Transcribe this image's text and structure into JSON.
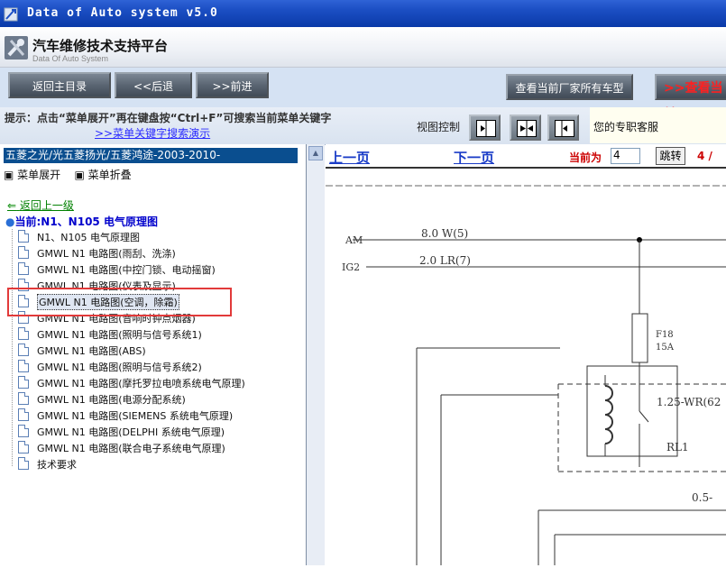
{
  "window": {
    "title": "Data of Auto system v5.0"
  },
  "header": {
    "title": "汽车维修技术支持平台",
    "subtitle": "Data Of Auto System"
  },
  "toolbar": {
    "home": "返回主目录",
    "back": "<<后退",
    "forward": ">>前进",
    "all_models": "查看当前厂家所有车型",
    "view_current": ">>查看当前"
  },
  "hints": {
    "tip": "提示：点击“菜单展开”再在键盘按“Ctrl+F”可搜索当前菜单关键字",
    "search_link": ">>菜单关键字搜索演示",
    "view_control": "视图控制",
    "agent": "您的专职客服"
  },
  "sidebar": {
    "breadcrumb": "五菱之光/光五菱扬光/五菱鸿途-2003-2010-",
    "expand": "菜单展开",
    "collapse": "菜单折叠",
    "back_up": "返回上一级",
    "current": "当前:N1、N105 电气原理图",
    "items": [
      {
        "label": "N1、N105 电气原理图"
      },
      {
        "label": "GMWL N1 电路图(雨刮、洗涤)"
      },
      {
        "label": "GMWL N1 电路图(中控门锁、电动摇窗)"
      },
      {
        "label": "GMWL N1 电路图(仪表及显示)"
      },
      {
        "label": "GMWL N1 电路图(空调，除霜)"
      },
      {
        "label": "GMWL N1 电路图(音响时钟点烟器)"
      },
      {
        "label": "GMWL N1 电路图(照明与信号系统1)"
      },
      {
        "label": "GMWL N1 电路图(ABS)"
      },
      {
        "label": "GMWL N1 电路图(照明与信号系统2)"
      },
      {
        "label": "GMWL N1 电路图(摩托罗拉电喷系统电气原理)"
      },
      {
        "label": "GMWL N1 电路图(电源分配系统)"
      },
      {
        "label": "GMWL N1 电路图(SIEMENS 系统电气原理)"
      },
      {
        "label": "GMWL N1 电路图(DELPHI 系统电气原理)"
      },
      {
        "label": "GMWL N1 电路图(联合电子系统电气原理)"
      },
      {
        "label": "技术要求"
      }
    ]
  },
  "docnav": {
    "prev": "上一页",
    "next": "下一页",
    "current_label": "当前为",
    "page_value": "4",
    "jump": "跳转",
    "page_count": "4 / "
  },
  "diagram": {
    "am": "AM",
    "ig2": "IG2",
    "w1": "8.0 W(5)",
    "w2": "2.0 LR(7)",
    "fuse": "F18",
    "fuse_amp": "15A",
    "wire3": "1.25-WR(62",
    "relay": "RL1",
    "wire4": "0.5-"
  },
  "colors": {
    "titlebar": "#1c4fc4",
    "breadcrumb_bg": "#0a4e8f",
    "highlight": "#e23a3a",
    "link": "#1a3cc7"
  }
}
